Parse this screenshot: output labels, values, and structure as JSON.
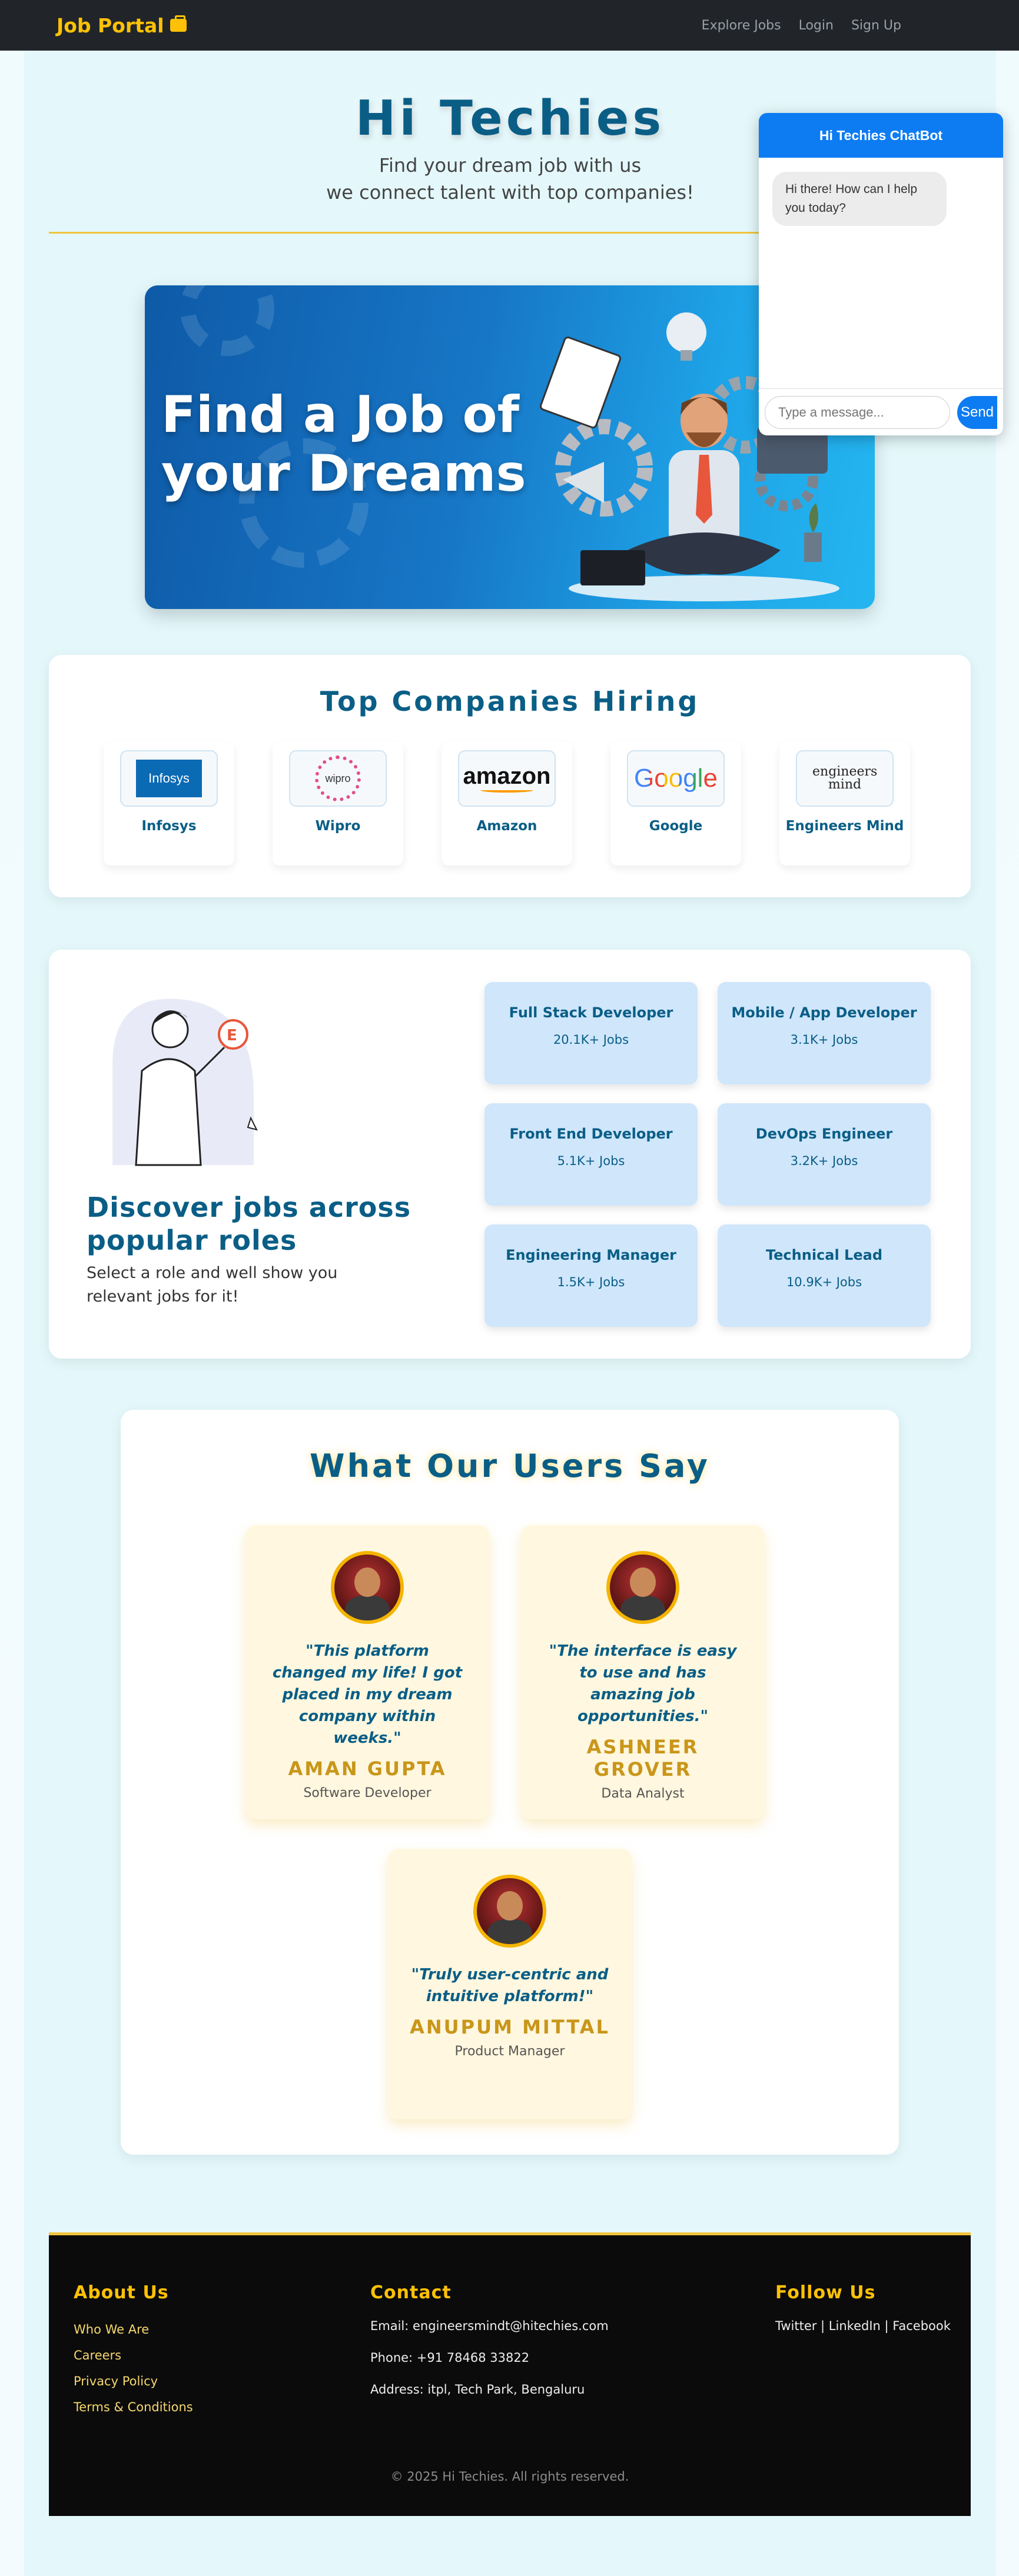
{
  "navbar": {
    "brand": "Job Portal",
    "links": [
      "Explore Jobs",
      "Login",
      "Sign Up"
    ]
  },
  "hero": {
    "title": "Hi Techies",
    "subtitle_line1": "Find your dream job with us",
    "subtitle_line2": "we connect talent with top companies!"
  },
  "banner": {
    "line1": "Find a Job of",
    "line2": "your Dreams"
  },
  "chatbot": {
    "title": "Hi Techies ChatBot",
    "greeting": "Hi there! How can I help you today?",
    "input_placeholder": "Type a message...",
    "send_label": "Send"
  },
  "companies": {
    "title": "Top Companies Hiring",
    "items": [
      {
        "name": "Infosys",
        "logo_text": "Infosys"
      },
      {
        "name": "Wipro",
        "logo_text": "wipro"
      },
      {
        "name": "Amazon",
        "logo_text": "amazon"
      },
      {
        "name": "Google",
        "logo_text": "Google"
      },
      {
        "name": "Engineers Mind",
        "logo_text": "engineers mind"
      }
    ]
  },
  "roles": {
    "title": "Discover jobs across popular roles",
    "subtitle": "Select a role and well show you relevant jobs for it!",
    "items": [
      {
        "title": "Full Stack Developer",
        "count": "20.1K+ Jobs"
      },
      {
        "title": "Mobile / App Developer",
        "count": "3.1K+ Jobs"
      },
      {
        "title": "Front End Developer",
        "count": "5.1K+ Jobs"
      },
      {
        "title": "DevOps Engineer",
        "count": "3.2K+ Jobs"
      },
      {
        "title": "Engineering Manager",
        "count": "1.5K+ Jobs"
      },
      {
        "title": "Technical Lead",
        "count": "10.9K+ Jobs"
      }
    ]
  },
  "testimonials": {
    "title": "What Our Users Say",
    "items": [
      {
        "quote": "\"This platform changed my life! I got placed in my dream company within weeks.\"",
        "name": "AMAN GUPTA",
        "role": "Software Developer"
      },
      {
        "quote": "\"The interface is easy to use and has amazing job opportunities.\"",
        "name": "ASHNEER GROVER",
        "role": "Data Analyst"
      },
      {
        "quote": "\"Truly user-centric and intuitive platform!\"",
        "name": "ANUPUM MITTAL",
        "role": "Product Manager"
      }
    ]
  },
  "footer": {
    "about_title": "About Us",
    "about_links": [
      "Who We Are",
      "Careers",
      "Privacy Policy",
      "Terms & Conditions"
    ],
    "contact_title": "Contact",
    "email": "Email: engineersmindt@hitechies.com",
    "phone": "Phone: +91 78468 33822",
    "address": "Address: itpl, Tech Park, Bengaluru",
    "follow_title": "Follow Us",
    "social": "Twitter | LinkedIn | Facebook",
    "copyright": "© 2025 Hi Techies. All rights reserved."
  }
}
